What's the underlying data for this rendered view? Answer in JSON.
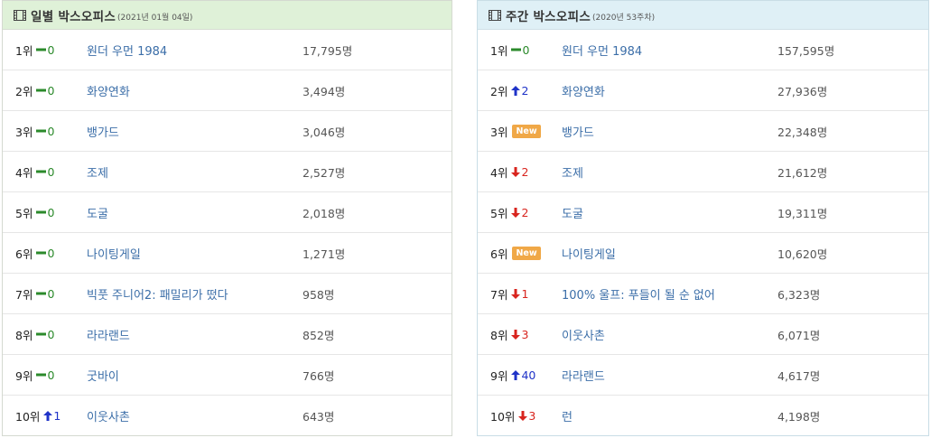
{
  "daily": {
    "title": "일별 박스오피스",
    "date": "(2021년 01월 04일)",
    "rows": [
      {
        "rank": "1위",
        "dir": "same",
        "chg": "0",
        "title": "원더 우먼 1984",
        "aud": "17,795명"
      },
      {
        "rank": "2위",
        "dir": "same",
        "chg": "0",
        "title": "화양연화",
        "aud": "3,494명"
      },
      {
        "rank": "3위",
        "dir": "same",
        "chg": "0",
        "title": "뱅가드",
        "aud": "3,046명"
      },
      {
        "rank": "4위",
        "dir": "same",
        "chg": "0",
        "title": "조제",
        "aud": "2,527명"
      },
      {
        "rank": "5위",
        "dir": "same",
        "chg": "0",
        "title": "도굴",
        "aud": "2,018명"
      },
      {
        "rank": "6위",
        "dir": "same",
        "chg": "0",
        "title": "나이팅게일",
        "aud": "1,271명"
      },
      {
        "rank": "7위",
        "dir": "same",
        "chg": "0",
        "title": "빅풋 주니어2: 패밀리가 떴다",
        "aud": "958명"
      },
      {
        "rank": "8위",
        "dir": "same",
        "chg": "0",
        "title": "라라랜드",
        "aud": "852명"
      },
      {
        "rank": "9위",
        "dir": "same",
        "chg": "0",
        "title": "굿바이",
        "aud": "766명"
      },
      {
        "rank": "10위",
        "dir": "up",
        "chg": "1",
        "title": "이웃사촌",
        "aud": "643명"
      }
    ]
  },
  "weekly": {
    "title": "주간 박스오피스",
    "date": "(2020년 53주차)",
    "rows": [
      {
        "rank": "1위",
        "dir": "same",
        "chg": "0",
        "title": "원더 우먼 1984",
        "aud": "157,595명"
      },
      {
        "rank": "2위",
        "dir": "up",
        "chg": "2",
        "title": "화양연화",
        "aud": "27,936명"
      },
      {
        "rank": "3위",
        "dir": "new",
        "chg": "New",
        "title": "뱅가드",
        "aud": "22,348명"
      },
      {
        "rank": "4위",
        "dir": "down",
        "chg": "2",
        "title": "조제",
        "aud": "21,612명"
      },
      {
        "rank": "5위",
        "dir": "down",
        "chg": "2",
        "title": "도굴",
        "aud": "19,311명"
      },
      {
        "rank": "6위",
        "dir": "new",
        "chg": "New",
        "title": "나이팅게일",
        "aud": "10,620명"
      },
      {
        "rank": "7위",
        "dir": "down",
        "chg": "1",
        "title": "100% 울프: 푸들이 될 순 없어",
        "aud": "6,323명"
      },
      {
        "rank": "8위",
        "dir": "down",
        "chg": "3",
        "title": "이웃사촌",
        "aud": "6,071명"
      },
      {
        "rank": "9위",
        "dir": "up",
        "chg": "40",
        "title": "라라랜드",
        "aud": "4,617명"
      },
      {
        "rank": "10위",
        "dir": "down",
        "chg": "3",
        "title": "런",
        "aud": "4,198명"
      }
    ]
  },
  "colors": {
    "same": "#2b8a2b",
    "up": "#1f33c8",
    "down": "#d8241e",
    "new_badge": "#f0a847",
    "link": "#3b6ea8"
  }
}
